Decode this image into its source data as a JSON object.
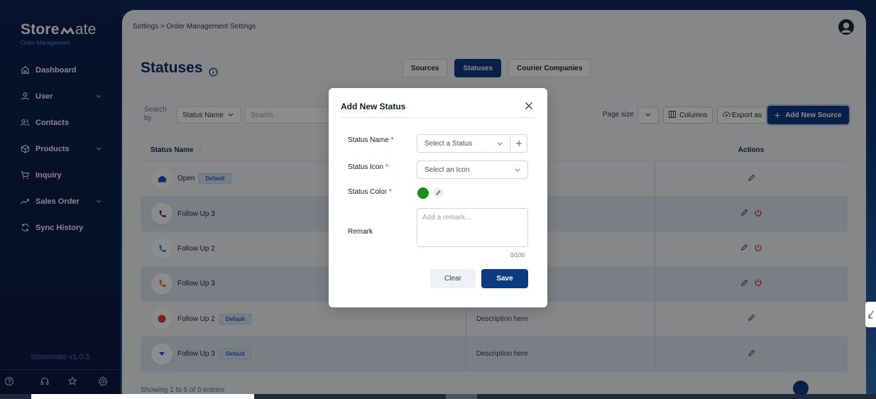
{
  "sidebar": {
    "logo_bold": "Store",
    "logo_light": "ate",
    "subtitle": "Order Management",
    "items": [
      {
        "label": "Dashboard",
        "icon": "home-icon",
        "has_chevron": false
      },
      {
        "label": "User",
        "icon": "user-icon",
        "has_chevron": true
      },
      {
        "label": "Contacts",
        "icon": "contacts-icon",
        "has_chevron": false
      },
      {
        "label": "Products",
        "icon": "box-icon",
        "has_chevron": true
      },
      {
        "label": "Inquiry",
        "icon": "cart-icon",
        "has_chevron": false
      },
      {
        "label": "Sales Order",
        "icon": "trend-icon",
        "has_chevron": true
      },
      {
        "label": "Sync History",
        "icon": "sync-icon",
        "has_chevron": false
      }
    ],
    "version": "Storemate v1.0.5"
  },
  "header": {
    "breadcrumb": "Settings > Order Management Settings"
  },
  "page": {
    "title": "Statuses",
    "tabs": [
      "Sources",
      "Statuses",
      "Courier Companies"
    ],
    "active_tab": "Statuses"
  },
  "toolbar": {
    "search_by_label": "Search by",
    "search_field": "Status Name",
    "search_placeholder": "Search...",
    "page_size_label": "Page size",
    "columns_label": "Columns",
    "export_label": "Export as",
    "add_label": "Add New Source"
  },
  "table": {
    "headers": {
      "name": "Status Name",
      "actions": "Actions"
    },
    "rows": [
      {
        "name": "Open",
        "badge": "Default",
        "description": "",
        "icon_color": "#1e4fb8",
        "icon": "home-shape-icon",
        "deletable": false
      },
      {
        "name": "Follow Up 3",
        "badge": "",
        "description": "",
        "icon_color": "#5b2a9e",
        "icon": "phone-icon",
        "deletable": true
      },
      {
        "name": "Follow Up 2",
        "badge": "",
        "description": "",
        "icon_color": "#1d8fb5",
        "icon": "phone-icon",
        "deletable": true
      },
      {
        "name": "Follow Up 3",
        "badge": "",
        "description": "",
        "icon_color": "#ea6a2a",
        "icon": "phone-icon",
        "deletable": true
      },
      {
        "name": "Follow Up 2",
        "badge": "Default",
        "description": "Description here",
        "icon_color": "#e53935",
        "icon": "circle-icon",
        "deletable": false
      },
      {
        "name": "Follow Up 3",
        "badge": "Default",
        "description": "Description here",
        "icon_color": "#1e4fb8",
        "icon": "caret-down-icon",
        "deletable": false
      }
    ],
    "footer_text": "Showing 1 to 6 of 6 entries"
  },
  "modal": {
    "title": "Add New Status",
    "status_name_label": "Status Name",
    "status_name_placeholder": "Select a Status",
    "status_icon_label": "Status Icon",
    "status_icon_placeholder": "Select an Icon",
    "status_color_label": "Status Color",
    "status_color": "#1f8a1f",
    "remark_label": "Remark",
    "remark_placeholder": "Add a remark...",
    "counter": "0/100",
    "clear_label": "Clear",
    "save_label": "Save"
  },
  "colors": {
    "primary": "#0d3b82",
    "danger": "#dc2626"
  }
}
